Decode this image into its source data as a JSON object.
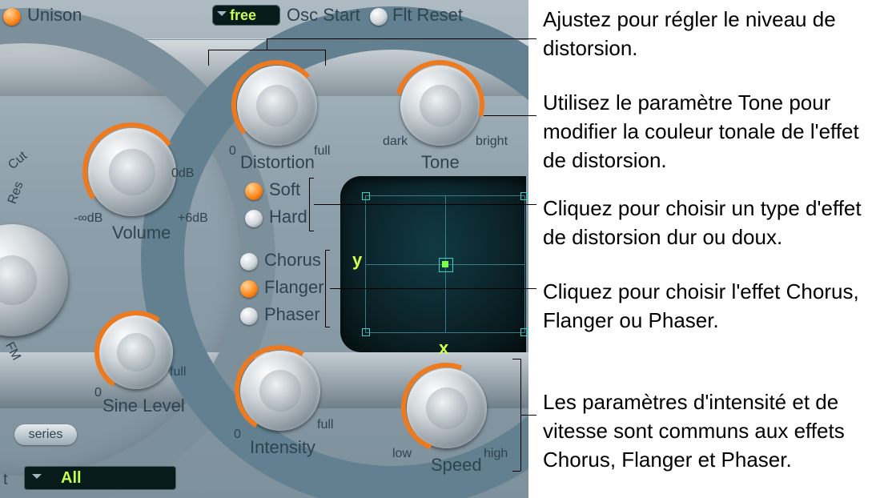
{
  "top": {
    "unison_label": "Unison",
    "osc_start_label": "Osc Start",
    "flt_reset_label": "Flt Reset",
    "osc_mode_value": "free"
  },
  "knobs": {
    "volume": {
      "label": "Volume",
      "left_tick": "-∞dB",
      "right_tick": "+6dB",
      "zero": "0dB"
    },
    "distortion": {
      "label": "Distortion",
      "left": "0",
      "right": "full"
    },
    "tone": {
      "label": "Tone",
      "left": "dark",
      "right": "bright"
    },
    "sine": {
      "label": "Sine Level",
      "left": "0",
      "right": "full"
    },
    "intensity": {
      "label": "Intensity",
      "left": "0",
      "right": "full"
    },
    "speed": {
      "label": "Speed",
      "left": "low",
      "right": "high"
    }
  },
  "dist_type": {
    "soft": "Soft",
    "hard": "Hard"
  },
  "mod_effect": {
    "chorus": "Chorus",
    "flanger": "Flanger",
    "phaser": "Phaser"
  },
  "sidebar": {
    "cut": "Cut",
    "res": "Res",
    "fm": "FM"
  },
  "xy": {
    "x": "x",
    "y": "y"
  },
  "series_badge": "series",
  "bottom": {
    "label_t": "t",
    "value": "All"
  },
  "callouts": {
    "c1": "Ajustez pour régler le niveau de distorsion.",
    "c2": "Utilisez le paramètre Tone pour modifier la couleur tonale de l'effet de distorsion.",
    "c3": "Cliquez pour choisir un type d'effet de distorsion dur ou doux.",
    "c4": "Cliquez pour choisir l'effet Chorus, Flanger ou Phaser.",
    "c5": "Les paramètres d'intensité et de vitesse sont communs aux effets Chorus, Flanger et Phaser."
  }
}
